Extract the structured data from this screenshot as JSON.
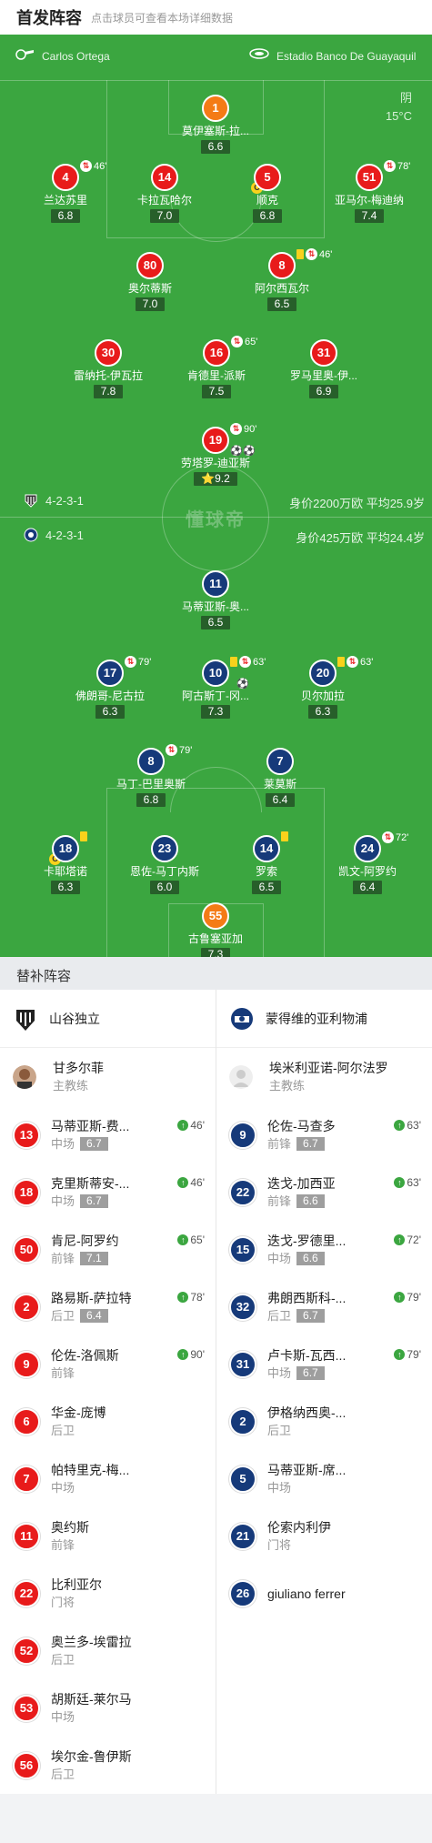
{
  "header": {
    "title": "首发阵容",
    "subtitle": "点击球员可查看本场详细数据"
  },
  "match": {
    "referee": "Carlos Ortega",
    "stadium": "Estadio Banco De Guayaquil",
    "weather": "阴",
    "temperature": "15°C"
  },
  "watermark": "懂球帝",
  "home": {
    "formation": "4-2-3-1",
    "value": "身价2200万欧  平均25.9岁",
    "players": [
      {
        "num": "1",
        "name": "莫伊塞斯-拉...",
        "rating": "6.6",
        "kind": "gk"
      },
      {
        "num": "4",
        "name": "兰达苏里",
        "rating": "6.8",
        "sub": "46'"
      },
      {
        "num": "14",
        "name": "卡拉瓦哈尔",
        "rating": "7.0"
      },
      {
        "num": "5",
        "name": "顺克",
        "rating": "6.8",
        "captain": "C"
      },
      {
        "num": "51",
        "name": "亚马尔-梅迪纳",
        "rating": "7.4",
        "sub": "78'"
      },
      {
        "num": "80",
        "name": "奥尔蒂斯",
        "rating": "7.0"
      },
      {
        "num": "8",
        "name": "阿尔西瓦尔",
        "rating": "6.5",
        "sub": "46'",
        "yellow": true
      },
      {
        "num": "30",
        "name": "雷纳托-伊瓦拉",
        "rating": "7.8"
      },
      {
        "num": "16",
        "name": "肯德里-派斯",
        "rating": "7.5",
        "sub": "65'"
      },
      {
        "num": "31",
        "name": "罗马里奥-伊...",
        "rating": "6.9"
      },
      {
        "num": "19",
        "name": "劳塔罗-迪亚斯",
        "rating": "9.2",
        "sub": "90'",
        "goals": "⚽⚽",
        "star": "⭐"
      }
    ]
  },
  "away": {
    "formation": "4-2-3-1",
    "value": "身价425万欧  平均24.4岁",
    "players": [
      {
        "num": "11",
        "name": "马蒂亚斯-奥...",
        "rating": "6.5"
      },
      {
        "num": "17",
        "name": "佛朗哥-尼古拉",
        "rating": "6.3",
        "sub": "79'"
      },
      {
        "num": "10",
        "name": "阿古斯丁-冈...",
        "rating": "7.3",
        "sub": "63'",
        "yellow": true,
        "goals": "⚽"
      },
      {
        "num": "20",
        "name": "贝尔加拉",
        "rating": "6.3",
        "sub": "63'",
        "yellow": true
      },
      {
        "num": "8",
        "name": "马丁-巴里奥斯",
        "rating": "6.8",
        "sub": "79'"
      },
      {
        "num": "7",
        "name": "莱莫斯",
        "rating": "6.4"
      },
      {
        "num": "18",
        "name": "卡耶塔诺",
        "rating": "6.3",
        "yellow": true,
        "captain": "C"
      },
      {
        "num": "23",
        "name": "恩佐-马丁内斯",
        "rating": "6.0"
      },
      {
        "num": "14",
        "name": "罗索",
        "rating": "6.5",
        "yellow": true
      },
      {
        "num": "24",
        "name": "凯文-阿罗约",
        "rating": "6.4",
        "sub": "72'"
      },
      {
        "num": "55",
        "name": "古鲁塞亚加",
        "rating": "7.3",
        "kind": "gk"
      }
    ]
  },
  "subs_section": {
    "title": "替补阵容"
  },
  "home_bench": {
    "team": "山谷独立",
    "coach": {
      "name": "甘多尔菲",
      "role": "主教练"
    },
    "players": [
      {
        "num": "13",
        "name": "马蒂亚斯-费...",
        "pos": "中场",
        "rating": "6.7",
        "in": "46'"
      },
      {
        "num": "18",
        "name": "克里斯蒂安-...",
        "pos": "中场",
        "rating": "6.7",
        "in": "46'"
      },
      {
        "num": "50",
        "name": "肯尼-阿罗约",
        "pos": "前锋",
        "rating": "7.1",
        "in": "65'"
      },
      {
        "num": "2",
        "name": "路易斯-萨拉特",
        "pos": "后卫",
        "rating": "6.4",
        "in": "78'"
      },
      {
        "num": "9",
        "name": "伦佐-洛佩斯",
        "pos": "前锋",
        "rating": "",
        "in": "90'"
      },
      {
        "num": "6",
        "name": "华金-庞博",
        "pos": "后卫"
      },
      {
        "num": "7",
        "name": "帕特里克-梅...",
        "pos": "中场"
      },
      {
        "num": "11",
        "name": "奥约斯",
        "pos": "前锋"
      },
      {
        "num": "22",
        "name": "比利亚尔",
        "pos": "门将"
      },
      {
        "num": "52",
        "name": "奥兰多-埃雷拉",
        "pos": "后卫"
      },
      {
        "num": "53",
        "name": "胡斯廷-莱尔马",
        "pos": "中场"
      },
      {
        "num": "56",
        "name": "埃尔金-鲁伊斯",
        "pos": "后卫"
      }
    ]
  },
  "away_bench": {
    "team": "蒙得维的亚利物浦",
    "coach": {
      "name": "埃米利亚诺-阿尔法罗",
      "role": "主教练"
    },
    "players": [
      {
        "num": "9",
        "name": "伦佐-马查多",
        "pos": "前锋",
        "rating": "6.7",
        "in": "63'"
      },
      {
        "num": "22",
        "name": "迭戈-加西亚",
        "pos": "前锋",
        "rating": "6.6",
        "in": "63'"
      },
      {
        "num": "15",
        "name": "迭戈-罗德里...",
        "pos": "中场",
        "rating": "6.6",
        "in": "72'"
      },
      {
        "num": "32",
        "name": "弗朗西斯科-...",
        "pos": "后卫",
        "rating": "6.7",
        "in": "79'"
      },
      {
        "num": "31",
        "name": "卢卡斯-瓦西...",
        "pos": "中场",
        "rating": "6.7",
        "in": "79'"
      },
      {
        "num": "2",
        "name": "伊格纳西奥-...",
        "pos": "后卫"
      },
      {
        "num": "5",
        "name": "马蒂亚斯-席...",
        "pos": "中场"
      },
      {
        "num": "21",
        "name": "伦索内利伊",
        "pos": "门将"
      },
      {
        "num": "26",
        "name": "giuliano ferrer",
        "pos": ""
      }
    ]
  },
  "colors": {
    "pitch": "#3ba640",
    "home": "#e81b1b",
    "away": "#163a7a",
    "gk": "#f47b16"
  }
}
